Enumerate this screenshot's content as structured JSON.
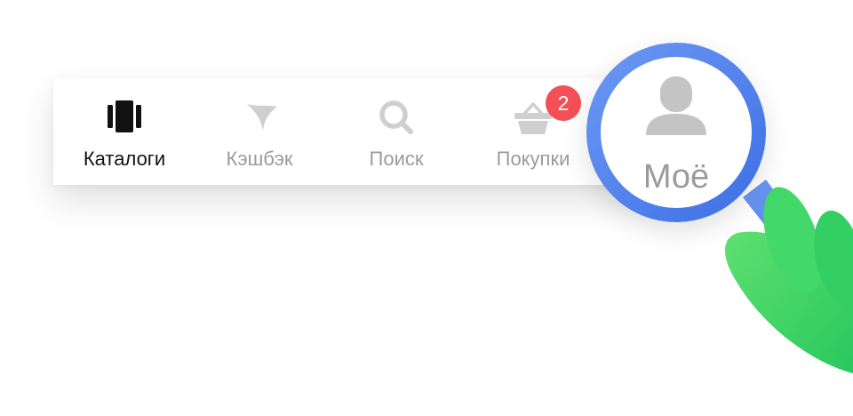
{
  "tabbar": {
    "tabs": [
      {
        "label": "Каталоги",
        "icon": "catalogs-icon",
        "active": true
      },
      {
        "label": "Кэшбэк",
        "icon": "cashback-icon",
        "active": false
      },
      {
        "label": "Поиск",
        "icon": "search-icon",
        "active": false
      },
      {
        "label": "Покупки",
        "icon": "basket-icon",
        "active": false,
        "badge": "2"
      }
    ]
  },
  "magnifier": {
    "label": "Моё",
    "icon": "user-icon"
  },
  "colors": {
    "active_text": "#111111",
    "inactive_text": "#9b9b9b",
    "badge": "#f44f56",
    "magnifier_ring": "#4d7ff0",
    "hand": "#3fd66a"
  }
}
